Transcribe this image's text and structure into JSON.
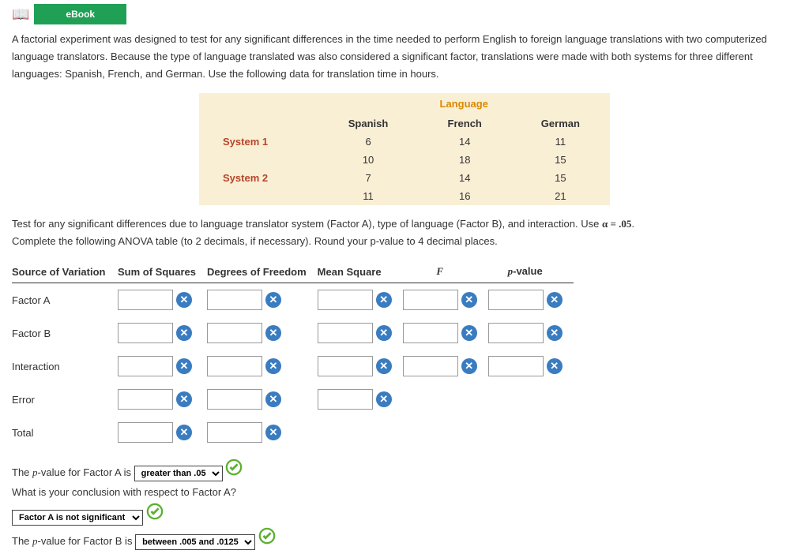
{
  "ebook_label": "eBook",
  "intro": "A factorial experiment was designed to test for any significant differences in the time needed to perform English to foreign language translations with two computerized language translators. Because the type of language translated was also considered a significant factor, translations were made with both systems for three different languages: Spanish, French, and German. Use the following data for translation time in hours.",
  "data_table": {
    "super_header": "Language",
    "columns": [
      "Spanish",
      "French",
      "German"
    ],
    "rows": [
      {
        "label": "System 1",
        "vals": [
          "6",
          "14",
          "11"
        ]
      },
      {
        "label": "",
        "vals": [
          "10",
          "18",
          "15"
        ]
      },
      {
        "label": "System 2",
        "vals": [
          "7",
          "14",
          "15"
        ]
      },
      {
        "label": "",
        "vals": [
          "11",
          "16",
          "21"
        ]
      }
    ]
  },
  "test_instruction_a": "Test for any significant differences due to language translator system (Factor A), type of language (Factor B), and interaction. Use ",
  "alpha_expr": "α = .05",
  "test_instruction_b": "Complete the following ANOVA table (to 2 decimals, if necessary). Round your p-value to 4 decimal places.",
  "anova": {
    "headers": [
      "Source of Variation",
      "Sum of Squares",
      "Degrees of Freedom",
      "Mean Square",
      "F",
      "p-value"
    ],
    "rows": [
      {
        "label": "Factor A",
        "cells": 5
      },
      {
        "label": "Factor B",
        "cells": 5
      },
      {
        "label": "Interaction",
        "cells": 5
      },
      {
        "label": "Error",
        "cells": 3
      },
      {
        "label": "Total",
        "cells": 2
      }
    ]
  },
  "followups": {
    "line1_a": "The ",
    "line1_b": "-value for Factor A is",
    "select1": "greater than .05",
    "line2": "What is your conclusion with respect to Factor A?",
    "select2": "Factor A is not significant",
    "line3_a": "The ",
    "line3_b": "-value for Factor B is",
    "select3": "between .005 and .0125"
  }
}
